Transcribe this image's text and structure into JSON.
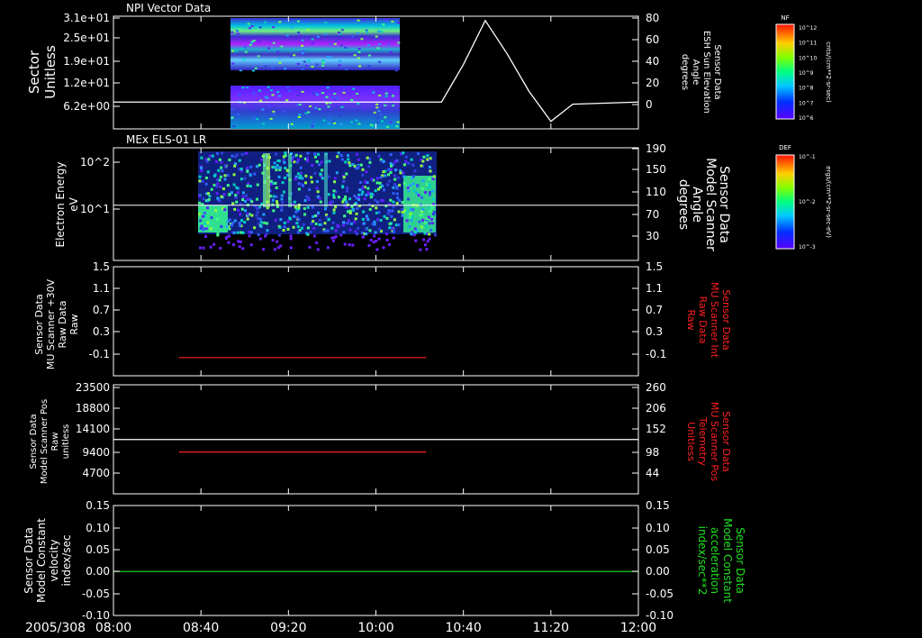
{
  "panels": [
    {
      "title": "NPI Vector Data",
      "left_label": [
        "Sector",
        "Unitless"
      ],
      "right_label": [
        "Sensor Data",
        "ESH Sun Elevation",
        "Angle",
        "degrees"
      ],
      "left_ticks": [
        "3.1e+01",
        "2.5e+01",
        "1.9e+01",
        "1.2e+01",
        "6.2e+00"
      ],
      "right_ticks": [
        "80",
        "60",
        "40",
        "20",
        "0"
      ],
      "right_color": "#ffffff",
      "colorbar": {
        "title": "NF",
        "unit": "cnts/(cm**2-sr-sec)",
        "labels": [
          "10^12",
          "10^11",
          "10^10",
          "10^9",
          "10^8",
          "10^7",
          "10^6"
        ]
      }
    },
    {
      "title": "MEx ELS-01 LR",
      "left_label": [
        "Electron Energy",
        "eV"
      ],
      "right_label": [
        "Sensor Data",
        "Model Scanner",
        "Angle",
        "degrees"
      ],
      "left_ticks": [
        "10^2",
        "10^1"
      ],
      "right_ticks": [
        "190",
        "150",
        "110",
        "70",
        "30"
      ],
      "right_color": "#ffffff",
      "colorbar": {
        "title": "DEF",
        "unit": "ergs/(cm**2-sr-sec-eV)",
        "labels": [
          "10^-1",
          "10^-2",
          "10^-3"
        ]
      }
    },
    {
      "left_label": [
        "Sensor Data",
        "MU Scanner +30V",
        "Raw Data",
        "Raw"
      ],
      "right_label": [
        "Sensor Data",
        "MU Scanner Int",
        "Raw Data",
        "Raw"
      ],
      "left_ticks": [
        "1.5",
        "1.1",
        "0.7",
        "0.3",
        "-0.1"
      ],
      "right_ticks": [
        "1.5",
        "1.1",
        "0.7",
        "0.3",
        "-0.1"
      ],
      "right_color": "#ff2020"
    },
    {
      "left_label": [
        "Sensor Data",
        "Model Scanner Pos",
        "Raw",
        "unitless"
      ],
      "right_label": [
        "Sensor Data",
        "MU Scanner Pos",
        "Telemetry",
        "Unitless"
      ],
      "left_ticks": [
        "23500",
        "18800",
        "14100",
        "9400",
        "4700"
      ],
      "right_ticks": [
        "260",
        "206",
        "152",
        "98",
        "44"
      ],
      "right_color": "#ff2020"
    },
    {
      "left_label": [
        "Sensor Data",
        "Model Constant",
        "velocity",
        "index/sec"
      ],
      "right_label": [
        "Sensor Data",
        "Model Constant",
        "acceleration",
        "index/sec**2"
      ],
      "left_ticks": [
        "0.15",
        "0.10",
        "0.05",
        "0.00",
        "-0.05",
        "-0.10"
      ],
      "right_ticks": [
        "0.15",
        "0.10",
        "0.05",
        "0.00",
        "-0.05",
        "-0.10"
      ],
      "right_color": "#20e020"
    }
  ],
  "time_axis": {
    "date": "2005/308",
    "labels": [
      "08:00",
      "08:40",
      "09:20",
      "10:00",
      "10:40",
      "11:20",
      "12:00"
    ]
  },
  "chart_data": [
    {
      "type": "heatmap",
      "title": "NPI Vector Data",
      "ylabel": "Sector Unitless",
      "y2label": "Sensor Data ESH Sun Elevation Angle degrees",
      "data_time_range": [
        "08:43",
        "10:06"
      ],
      "overlay_line": {
        "name": "ESH Sun Elevation Angle",
        "x": [
          "08:00",
          "10:30",
          "10:40",
          "10:50",
          "11:00",
          "11:10",
          "11:20",
          "11:30",
          "12:00"
        ],
        "y": [
          0,
          0,
          35,
          76,
          45,
          10,
          -18,
          -2,
          0
        ]
      }
    },
    {
      "type": "heatmap",
      "title": "MEx ELS-01 LR",
      "ylabel": "Electron Energy eV",
      "y2label": "Sensor Data Model Scanner Angle degrees",
      "data_time_range": [
        "08:30",
        "10:22"
      ],
      "overlay_line": {
        "name": "Model Scanner Angle",
        "x": [
          "08:00",
          "12:00"
        ],
        "y": [
          88,
          88
        ]
      }
    },
    {
      "type": "line",
      "ylabel": "Sensor Data MU Scanner +30V Raw Data Raw",
      "y2label": "Sensor Data MU Scanner Int Raw Data Raw",
      "ylim": [
        -0.3,
        1.5
      ],
      "series": [
        {
          "name": "MU Scanner Int",
          "x": [
            "08:30",
            "10:23"
          ],
          "y": [
            0.0,
            0.0
          ],
          "color": "#ff2020"
        }
      ]
    },
    {
      "type": "line",
      "ylabel": "Sensor Data Model Scanner Pos Raw unitless",
      "y2label": "Sensor Data MU Scanner Pos Telemetry Unitless",
      "ylim": [
        0,
        23500
      ],
      "series": [
        {
          "name": "Model Scanner Pos",
          "x": [
            "08:00",
            "12:00"
          ],
          "y": [
            11700,
            11700
          ],
          "color": "#ffffff"
        },
        {
          "name": "MU Scanner Pos",
          "x": [
            "08:30",
            "10:23"
          ],
          "y": [
            9000,
            9000
          ],
          "color": "#ff2020"
        }
      ]
    },
    {
      "type": "line",
      "ylabel": "Sensor Data Model Constant velocity index/sec",
      "y2label": "Sensor Data Model Constant acceleration index/sec**2",
      "ylim": [
        -0.1,
        0.15
      ],
      "series": [
        {
          "name": "Model Constant acceleration",
          "x": [
            "08:00",
            "12:00"
          ],
          "y": [
            0.0,
            0.0
          ],
          "color": "#20e020"
        }
      ]
    }
  ]
}
